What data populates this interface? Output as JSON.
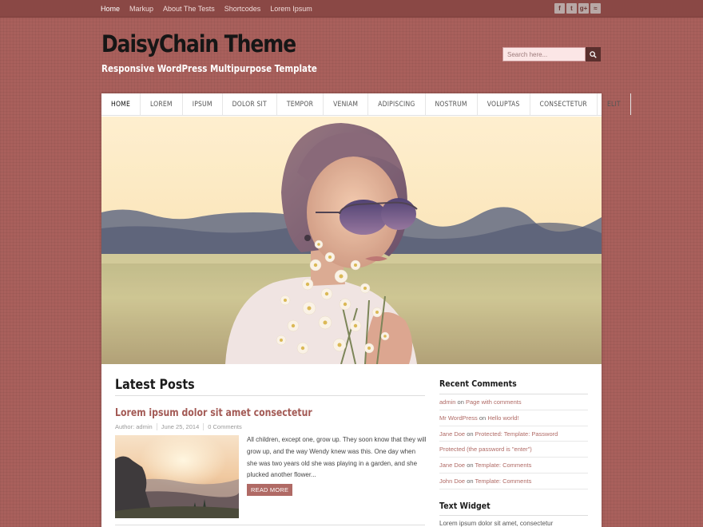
{
  "topbar": {
    "menu": [
      {
        "label": "Home",
        "active": true
      },
      {
        "label": "Markup"
      },
      {
        "label": "About The Tests"
      },
      {
        "label": "Shortcodes"
      },
      {
        "label": "Lorem Ipsum"
      }
    ],
    "social": [
      {
        "glyph": "f",
        "icon": "facebook-icon"
      },
      {
        "glyph": "t",
        "icon": "twitter-icon"
      },
      {
        "glyph": "g+",
        "icon": "google-plus-icon"
      },
      {
        "glyph": "≈",
        "icon": "rss-icon"
      }
    ]
  },
  "header": {
    "title": "DaisyChain Theme",
    "description": "Responsive WordPress Multipurpose Template",
    "search_placeholder": "Search here..."
  },
  "nav": [
    {
      "label": "HOME",
      "active": true
    },
    {
      "label": "LOREM"
    },
    {
      "label": "IPSUM"
    },
    {
      "label": "DOLOR SIT"
    },
    {
      "label": "TEMPOR"
    },
    {
      "label": "VENIAM"
    },
    {
      "label": "ADIPISCING"
    },
    {
      "label": "NOSTRUM"
    },
    {
      "label": "VOLUPTAS"
    },
    {
      "label": "CONSECTETUR"
    },
    {
      "label": "ELIT"
    }
  ],
  "content": {
    "heading": "Latest Posts",
    "post": {
      "title": "Lorem ipsum dolor sit amet consectetur",
      "author": "Author: admin",
      "date": "June 25, 2014",
      "comments": "0 Comments",
      "excerpt": "All children, except one, grow up. They soon know that they will grow up, and the way Wendy knew was this. One day when she was two years old she was playing in a garden, and she plucked another flower...",
      "read_more": "READ MORE"
    }
  },
  "sidebar": {
    "recent_title": "Recent Comments",
    "comments": [
      {
        "author": "admin",
        "on": "on",
        "post": "Page with comments"
      },
      {
        "author": "Mr WordPress",
        "on": "on",
        "post": "Hello world!"
      },
      {
        "author": "Jane Doe",
        "on": "on",
        "post": "Protected: Template: Password"
      },
      {
        "author": "",
        "on": "",
        "post": "Protected (the password is \"enter\")"
      },
      {
        "author": "Jane Doe",
        "on": "on",
        "post": "Template: Comments"
      },
      {
        "author": "John Doe",
        "on": "on",
        "post": "Template: Comments"
      }
    ],
    "text_widget_title": "Text Widget",
    "text_widget_body": "Lorem ipsum dolor sit amet, consectetur"
  }
}
